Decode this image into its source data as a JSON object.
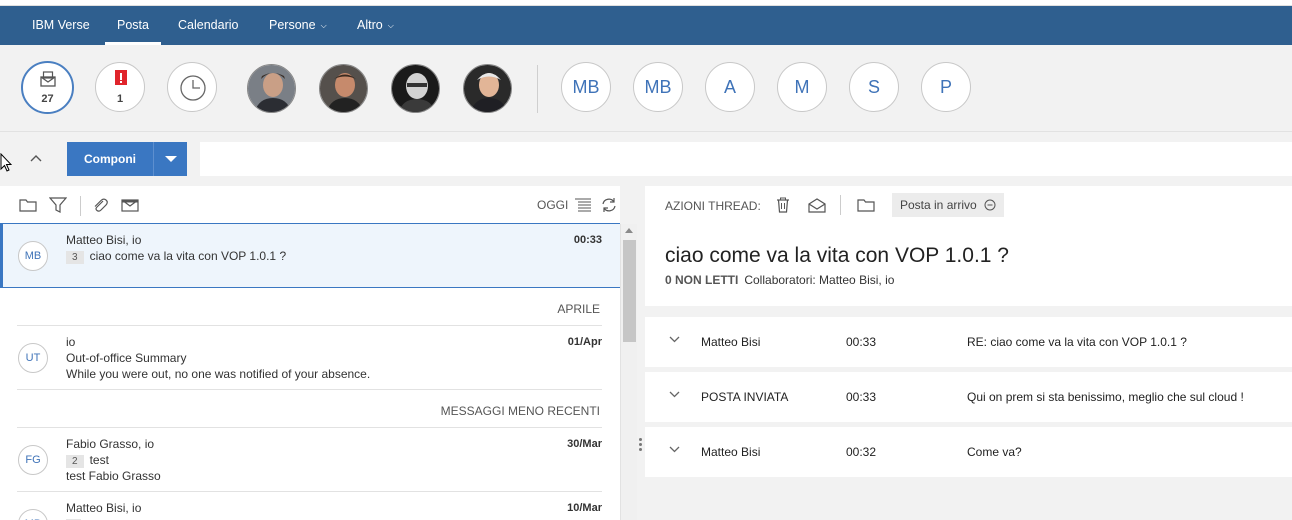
{
  "nav": {
    "items": [
      {
        "label": "IBM Verse"
      },
      {
        "label": "Posta"
      },
      {
        "label": "Calendario"
      },
      {
        "label": "Persone"
      },
      {
        "label": "Altro"
      }
    ]
  },
  "people_bar": {
    "inbox_count": "27",
    "important_count": "1",
    "contacts_initials": [
      "MB",
      "MB",
      "A",
      "M",
      "S",
      "P"
    ]
  },
  "compose": {
    "label": "Componi"
  },
  "list_toolbar": {
    "sort_label": "OGGI"
  },
  "mail_list": {
    "items": [
      {
        "avatar": "MB",
        "from": "Matteo Bisi, io",
        "time": "00:33",
        "count": "3",
        "subject": "ciao come va la vita con VOP 1.0.1 ?"
      },
      {
        "avatar": "UT",
        "from": "io",
        "time": "01/Apr",
        "subject": "Out-of-office Summary",
        "preview": "While you were out, no one was notified of your absence."
      },
      {
        "avatar": "FG",
        "from": "Fabio Grasso, io",
        "time": "30/Mar",
        "count": "2",
        "subject": "test",
        "preview": "test Fabio Grasso"
      },
      {
        "avatar": "MB",
        "from": "Matteo Bisi, io",
        "time": "10/Mar"
      }
    ],
    "sections": [
      "APRILE",
      "MESSAGGI MENO RECENTI"
    ]
  },
  "thread_toolbar": {
    "label": "AZIONI THREAD:",
    "folder": "Posta in arrivo"
  },
  "thread": {
    "title": "ciao come va la vita con VOP 1.0.1 ?",
    "unread": "0 NON LETTI",
    "collaborators": "Collaboratori: Matteo Bisi, io",
    "messages": [
      {
        "from": "Matteo Bisi",
        "time": "00:33",
        "subject": "RE: ciao come va la vita con VOP 1.0.1 ?"
      },
      {
        "from": "POSTA INVIATA",
        "time": "00:33",
        "subject": "Qui on prem si sta benissimo, meglio che sul cloud !"
      },
      {
        "from": "Matteo Bisi",
        "time": "00:32",
        "subject": "Come va?"
      }
    ]
  },
  "colors": {
    "nav_bg": "#2f5f8f",
    "accent": "#3a77c2",
    "badge_red": "#e0242b"
  }
}
